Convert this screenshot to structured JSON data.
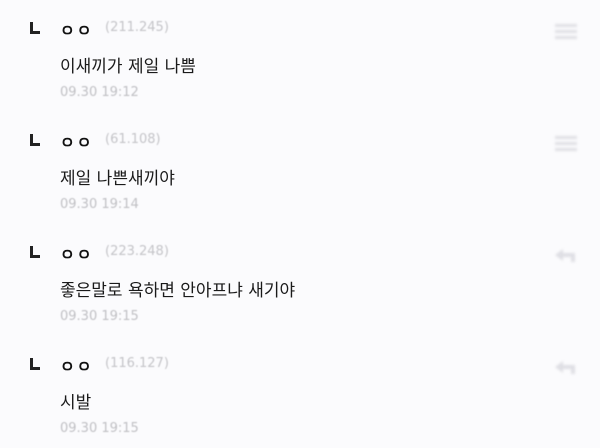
{
  "comments": [
    {
      "nick": "ㅇㅇ",
      "ip": "(211.245)",
      "text": "이새끼가 제일 나쁨",
      "time": "09.30 19:12",
      "action_icon": "menu-lines-icon"
    },
    {
      "nick": "ㅇㅇ",
      "ip": "(61.108)",
      "text": "제일 나쁜새끼야",
      "time": "09.30 19:14",
      "action_icon": "menu-lines-icon"
    },
    {
      "nick": "ㅇㅇ",
      "ip": "(223.248)",
      "text": "좋은말로 욕하면 안아프냐 새기야",
      "time": "09.30 19:15",
      "action_icon": "reply-arrow-icon"
    },
    {
      "nick": "ㅇㅇ",
      "ip": "(116.127)",
      "text": "시발",
      "time": "09.30 19:15",
      "action_icon": "reply-arrow-icon"
    }
  ]
}
